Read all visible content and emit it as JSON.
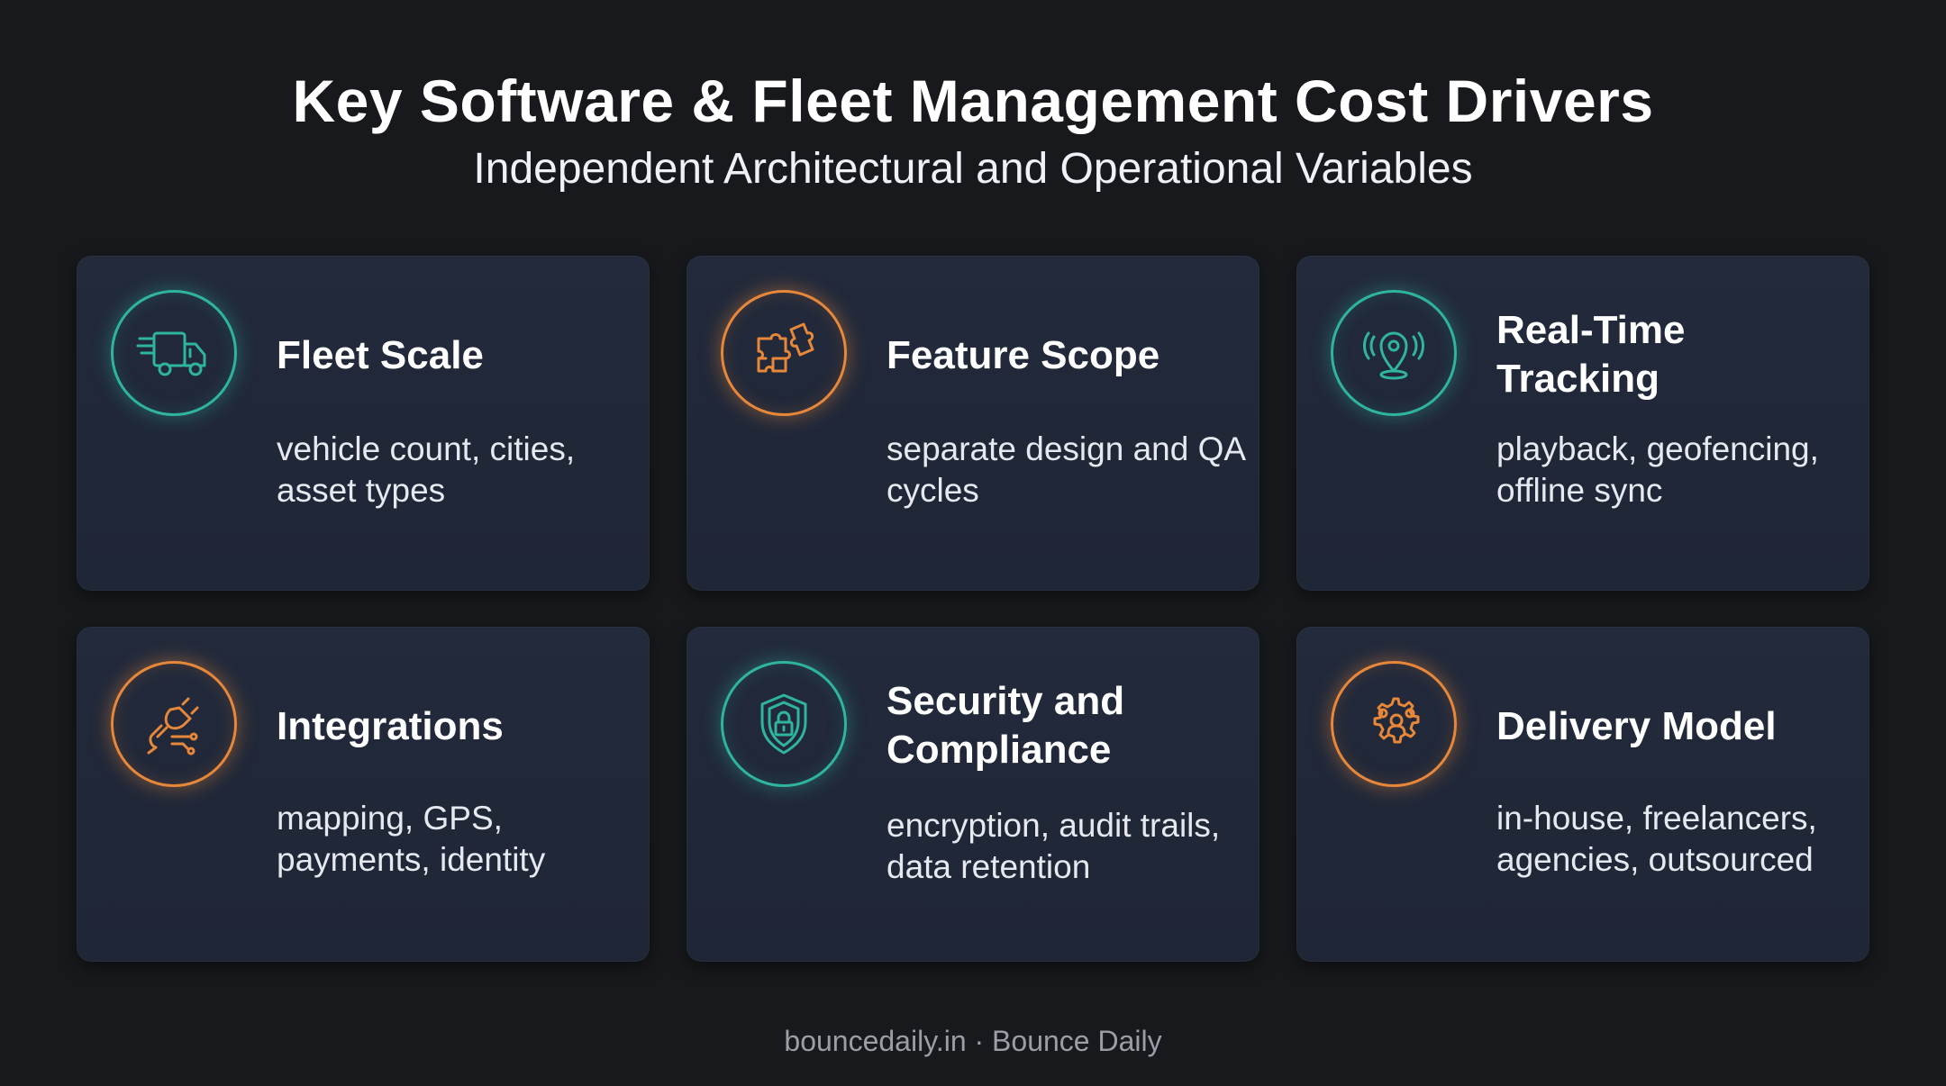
{
  "header": {
    "title": "Key Software & Fleet Management Cost Drivers",
    "subtitle": "Independent Architectural and Operational Variables"
  },
  "cards": [
    {
      "title": "Fleet Scale",
      "description": "vehicle count, cities, asset types",
      "icon": "delivery-truck-icon",
      "accent": "#2fb4a0"
    },
    {
      "title": "Feature Scope",
      "description": "separate design and QA cycles",
      "icon": "puzzle-icon",
      "accent": "#e7873a"
    },
    {
      "title": "Real-Time Tracking",
      "description": "playback, geofencing, offline sync",
      "icon": "location-pin-icon",
      "accent": "#2fb4a0"
    },
    {
      "title": "Integrations",
      "description": "mapping, GPS, payments, identity",
      "icon": "plug-icon",
      "accent": "#e7873a"
    },
    {
      "title": "Security and Compliance",
      "description": "encryption, audit trails, data retention",
      "icon": "shield-lock-icon",
      "accent": "#2fb4a0"
    },
    {
      "title": "Delivery Model",
      "description": "in-house, freelancers, agencies, outsourced",
      "icon": "team-gear-icon",
      "accent": "#e7873a"
    }
  ],
  "footer": {
    "text": "bouncedaily.in · Bounce Daily"
  },
  "colors": {
    "background": "#18191c",
    "card": "#222a3b",
    "teal": "#2fb4a0",
    "orange": "#e7873a"
  }
}
